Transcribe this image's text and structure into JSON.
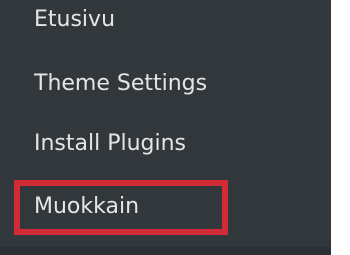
{
  "menu": {
    "items": [
      {
        "label": "Etusivu"
      },
      {
        "label": "Theme Settings"
      },
      {
        "label": "Install Plugins"
      },
      {
        "label": "Muokkain"
      }
    ],
    "highlighted_index": 3
  },
  "colors": {
    "panel_background": "#32373c",
    "text": "#e3e6e8",
    "highlight_border": "#d12b35",
    "page_background": "#ffffff"
  }
}
